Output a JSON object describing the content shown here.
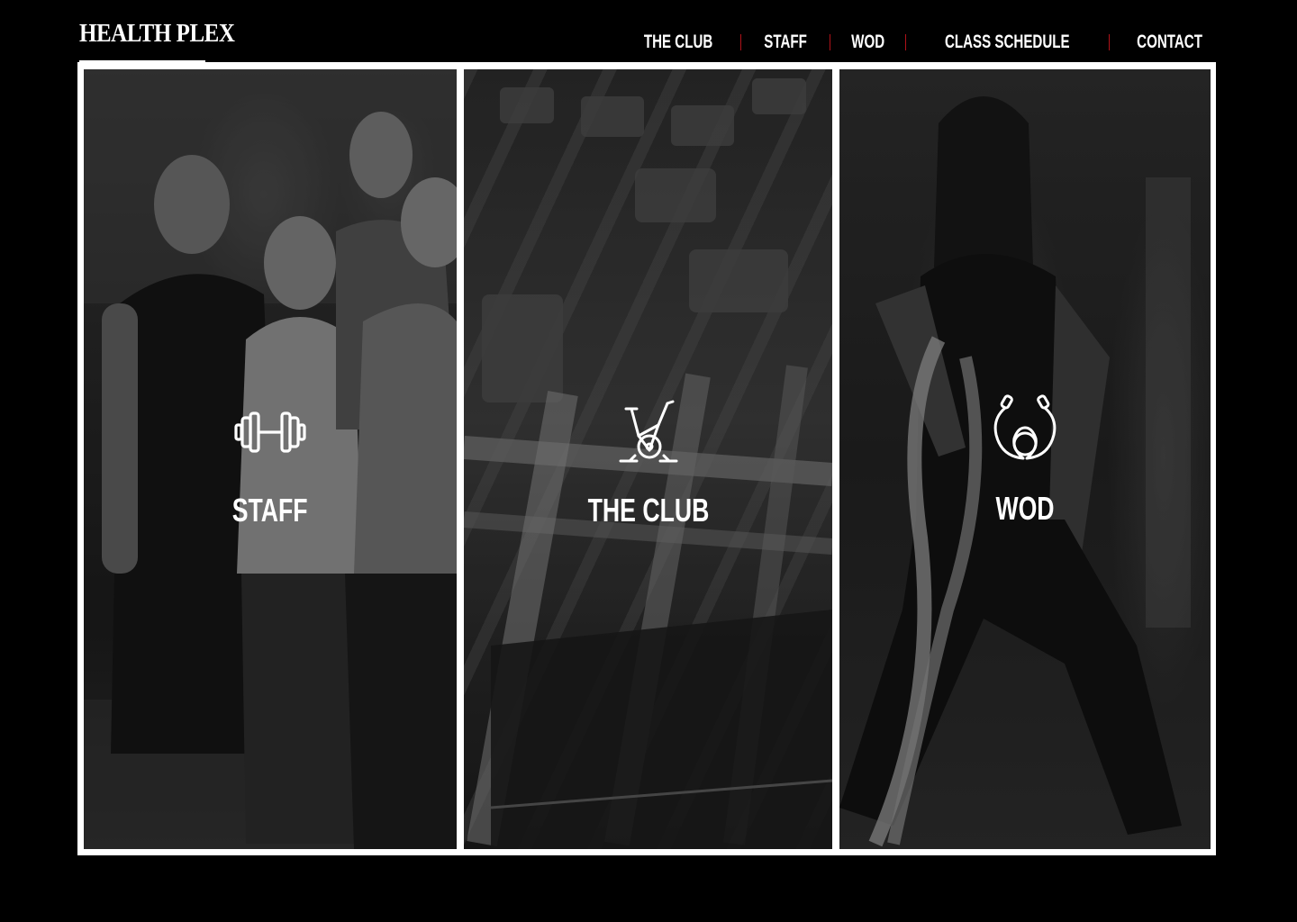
{
  "brand": {
    "logo_text": "HEALTH PLEX",
    "accent_color": "#d3151c"
  },
  "nav": {
    "items": [
      {
        "label": "THE CLUB"
      },
      {
        "label": "STAFF"
      },
      {
        "label": "WOD"
      },
      {
        "label": "CLASS SCHEDULE"
      },
      {
        "label": "CONTACT"
      }
    ]
  },
  "panels": [
    {
      "label": "STAFF",
      "icon": "dumbbell-icon",
      "image": "staff-group-photo"
    },
    {
      "label": "THE CLUB",
      "icon": "exercise-bike-icon",
      "image": "gym-treadmills-photo"
    },
    {
      "label": "WOD",
      "icon": "jump-rope-icon",
      "image": "battle-rope-photo"
    }
  ]
}
